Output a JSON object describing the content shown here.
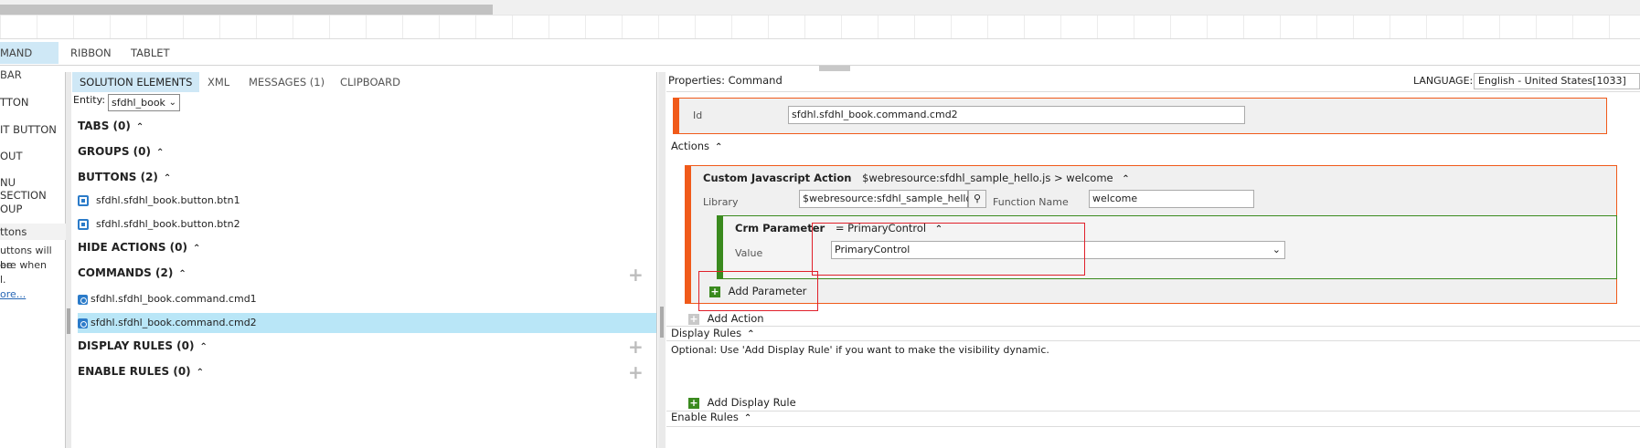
{
  "ribbon_tabs": [
    "MAND BAR",
    "RIBBON",
    "TABLET"
  ],
  "left_panel": {
    "items": [
      "TTON",
      "IT BUTTON",
      "OUT",
      "NU SECTION",
      "OUP",
      "ttons"
    ],
    "description": [
      "uttons will be",
      "ere when",
      "l."
    ],
    "more_link": "ore..."
  },
  "middle": {
    "tabs": [
      "SOLUTION ELEMENTS",
      "XML",
      "MESSAGES (1)",
      "CLIPBOARD"
    ],
    "entity_label": "Entity:",
    "entity_value": "sfdhl_book",
    "sections": {
      "tabs": "TABS (0)",
      "groups": "GROUPS (0)",
      "buttons": "BUTTONS (2)",
      "hide_actions": "HIDE ACTIONS (0)",
      "commands": "COMMANDS (2)",
      "display_rules": "DISPLAY RULES (0)",
      "enable_rules": "ENABLE RULES (0)"
    },
    "buttons": [
      "sfdhl.sfdhl_book.button.btn1",
      "sfdhl.sfdhl_book.button.btn2"
    ],
    "commands": [
      "sfdhl.sfdhl_book.command.cmd1",
      "sfdhl.sfdhl_book.command.cmd2"
    ]
  },
  "properties": {
    "title": "Properties: Command",
    "language_label": "LANGUAGE:",
    "language_value": "English - United States[1033]",
    "id_label": "Id",
    "id_value": "sfdhl.sfdhl_book.command.cmd2",
    "actions_label": "Actions",
    "action": {
      "title": "Custom Javascript Action",
      "summary": "$webresource:sfdhl_sample_hello.js > welcome",
      "library_label": "Library",
      "library_value": "$webresource:sfdhl_sample_hello.js",
      "function_label": "Function Name",
      "function_value": "welcome",
      "param_title": "Crm Parameter",
      "param_summary": "= PrimaryControl",
      "value_label": "Value",
      "value_selected": "PrimaryControl",
      "add_parameter": "Add Parameter"
    },
    "add_action": "Add Action",
    "display_rules_label": "Display Rules",
    "display_rules_hint": "Optional: Use 'Add Display Rule' if you want to make the visibility dynamic.",
    "add_display_rule": "Add Display Rule",
    "enable_rules_label": "Enable Rules"
  },
  "colors": {
    "accent_blue": "#cfe8f6",
    "selected_row": "#b9e6f7",
    "orange": "#f05a1a",
    "green": "#3a8a1e",
    "highlight_red": "#e0202a"
  },
  "icons": [
    "button-icon",
    "command-icon",
    "search-icon",
    "plus-icon",
    "caret-up-icon",
    "chevron-down-icon"
  ]
}
